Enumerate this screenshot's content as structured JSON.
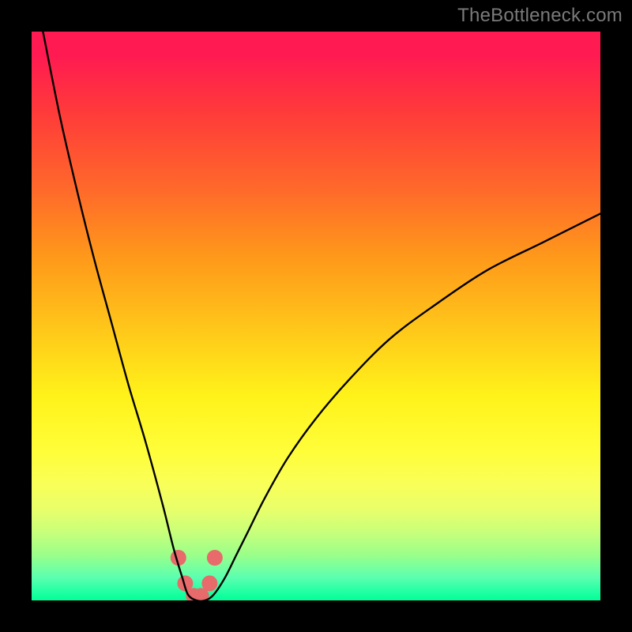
{
  "watermark": "TheBottleneck.com",
  "chart_data": {
    "type": "line",
    "title": "",
    "xlabel": "",
    "ylabel": "",
    "xlim": [
      0,
      100
    ],
    "ylim": [
      0,
      100
    ],
    "grid": false,
    "background": {
      "type": "vertical-gradient",
      "description": "red (top) → orange → yellow → green (bottom)",
      "stops": [
        {
          "pos": 0.0,
          "color": "#ff1a52"
        },
        {
          "pos": 0.04,
          "color": "#ff1a52"
        },
        {
          "pos": 0.14,
          "color": "#ff3a3a"
        },
        {
          "pos": 0.28,
          "color": "#ff6a2a"
        },
        {
          "pos": 0.4,
          "color": "#ff9a1a"
        },
        {
          "pos": 0.52,
          "color": "#ffc61a"
        },
        {
          "pos": 0.64,
          "color": "#fff21a"
        },
        {
          "pos": 0.74,
          "color": "#fffe3a"
        },
        {
          "pos": 0.8,
          "color": "#f8ff5a"
        },
        {
          "pos": 0.84,
          "color": "#e8ff6a"
        },
        {
          "pos": 0.88,
          "color": "#c8ff7a"
        },
        {
          "pos": 0.92,
          "color": "#9aff8a"
        },
        {
          "pos": 0.96,
          "color": "#5affb0"
        },
        {
          "pos": 1.0,
          "color": "#00ff9a"
        }
      ]
    },
    "series": [
      {
        "name": "curve",
        "color": "#000000",
        "stroke_width": 2,
        "x": [
          2,
          5,
          8,
          11,
          14,
          17,
          20,
          23,
          25,
          26.5,
          27.5,
          29,
          30.5,
          32,
          34,
          36,
          38,
          41,
          45,
          50,
          56,
          63,
          71,
          80,
          90,
          100
        ],
        "y": [
          100,
          85,
          72,
          60,
          49,
          38,
          28,
          17,
          9,
          4,
          1,
          0,
          0,
          1,
          4,
          8,
          12,
          18,
          25,
          32,
          39,
          46,
          52,
          58,
          63,
          68
        ]
      },
      {
        "name": "dip-markers",
        "type": "scatter",
        "color": "#e86a6a",
        "radius": 10,
        "x": [
          25.8,
          27.0,
          28.5,
          29.8,
          31.3,
          32.2
        ],
        "y": [
          7.5,
          3.0,
          0.8,
          0.8,
          3.0,
          7.5
        ]
      }
    ],
    "annotations": []
  }
}
